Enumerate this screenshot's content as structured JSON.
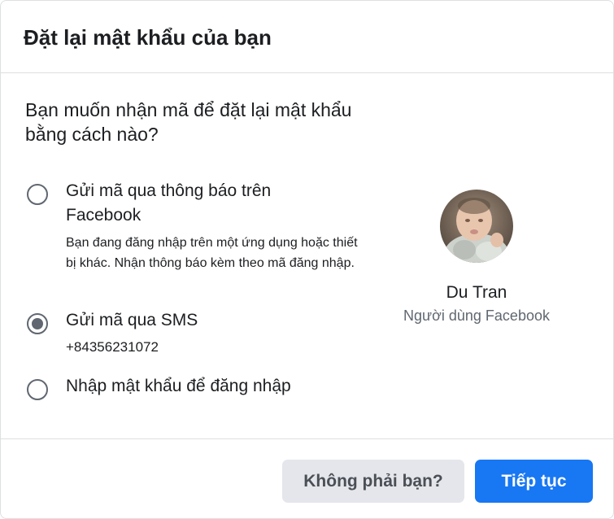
{
  "dialog": {
    "title": "Đặt lại mật khẩu của bạn",
    "question": "Bạn muốn nhận mã để đặt lại mật khẩu bằng cách nào?",
    "options": [
      {
        "title": "Gửi mã qua thông báo trên Facebook",
        "description": "Bạn đang đăng nhập trên một ứng dụng hoặc thiết bị khác. Nhận thông báo kèm theo mã đăng nhập.",
        "selected": false
      },
      {
        "title": "Gửi mã qua SMS",
        "description": "+84356231072",
        "selected": true
      },
      {
        "title": "Nhập mật khẩu để đăng nhập",
        "selected": false
      }
    ],
    "profile": {
      "name": "Du Tran",
      "subtitle": "Người dùng Facebook"
    },
    "buttons": {
      "not_you": "Không phải bạn?",
      "continue": "Tiếp tục"
    }
  },
  "colors": {
    "primary": "#1877f2",
    "secondary_button": "#e4e6eb",
    "text": "#1c1e21",
    "muted_text": "#606770",
    "divider": "#dddfe2"
  }
}
